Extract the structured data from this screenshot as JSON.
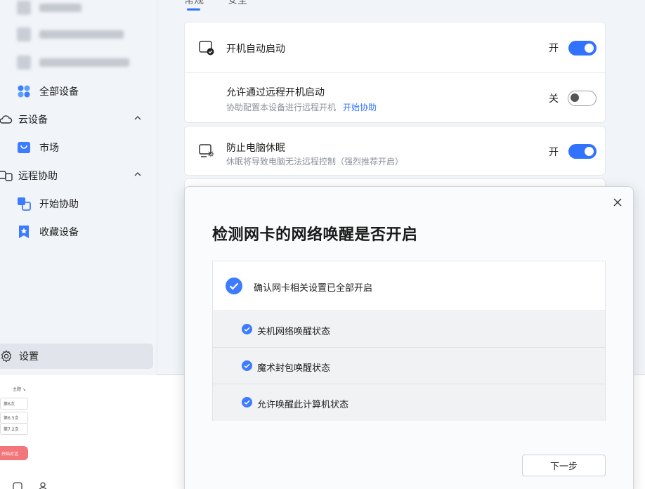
{
  "sidebar": {
    "all_devices": "全部设备",
    "cloud_devices": "云设备",
    "market": "市场",
    "remote_assist": "远程协助",
    "start_assist": "开始协助",
    "favorite_devices": "收藏设备",
    "settings": "设置"
  },
  "content": {
    "tabs": [
      "常规",
      "安全"
    ],
    "rows": {
      "auto_start": {
        "title": "开机自动启动",
        "state": "开"
      },
      "remote_boot": {
        "title": "允许通过远程开机启动",
        "sub": "协助配置本设备进行远程开机",
        "link": "开始协助",
        "state": "关"
      },
      "prevent_sleep": {
        "title": "防止电脑休眠",
        "sub": "休眠将导致电脑无法远程控制（强烈推荐开启）",
        "state": "开"
      }
    }
  },
  "bg_window": {
    "items": [
      "主题 ↘",
      "第6次",
      "第6.5次",
      "第7.2次"
    ],
    "red_button": "开始对话"
  },
  "dialog": {
    "title": "检测网卡的网络唤醒是否开启",
    "main_check": "确认网卡相关设置已全部开启",
    "sub_checks": [
      "关机网络唤醒状态",
      "魔术封包唤醒状态",
      "允许唤醒此计算机状态"
    ],
    "next_button": "下一步"
  },
  "colors": {
    "accent": "#3173ff",
    "check": "#3d7bff"
  }
}
